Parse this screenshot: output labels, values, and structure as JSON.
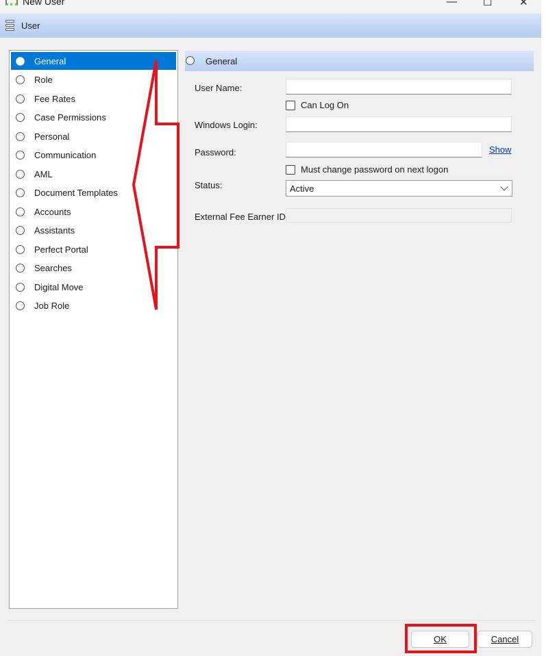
{
  "window": {
    "title": "New User",
    "minimize": "—",
    "maximize": "☐",
    "close": "✕"
  },
  "header": {
    "title": "User",
    "icon": "stack-icon"
  },
  "sidebar": {
    "items": [
      {
        "label": "General",
        "selected": true
      },
      {
        "label": "Role"
      },
      {
        "label": "Fee Rates"
      },
      {
        "label": "Case Permissions"
      },
      {
        "label": "Personal"
      },
      {
        "label": "Communication"
      },
      {
        "label": "AML"
      },
      {
        "label": "Document Templates"
      },
      {
        "label": "Accounts"
      },
      {
        "label": "Assistants"
      },
      {
        "label": "Perfect Portal"
      },
      {
        "label": "Searches"
      },
      {
        "label": "Digital Move"
      },
      {
        "label": "Job Role"
      }
    ]
  },
  "panel": {
    "title": "General",
    "user_name_label": "User Name:",
    "user_name_value": "",
    "can_log_on_label": "Can Log On",
    "can_log_on_checked": false,
    "windows_login_label": "Windows Login:",
    "windows_login_value": "",
    "password_label": "Password:",
    "password_value": "",
    "show_link": "Show",
    "must_change_label": "Must change password on next logon",
    "must_change_checked": false,
    "status_label": "Status:",
    "status_value": "Active",
    "external_id_label": "External Fee Earner ID:",
    "external_id_value": ""
  },
  "footer": {
    "ok_label": "OK",
    "cancel_label": "Cancel"
  },
  "annotation": {
    "color": "#e8121e"
  }
}
